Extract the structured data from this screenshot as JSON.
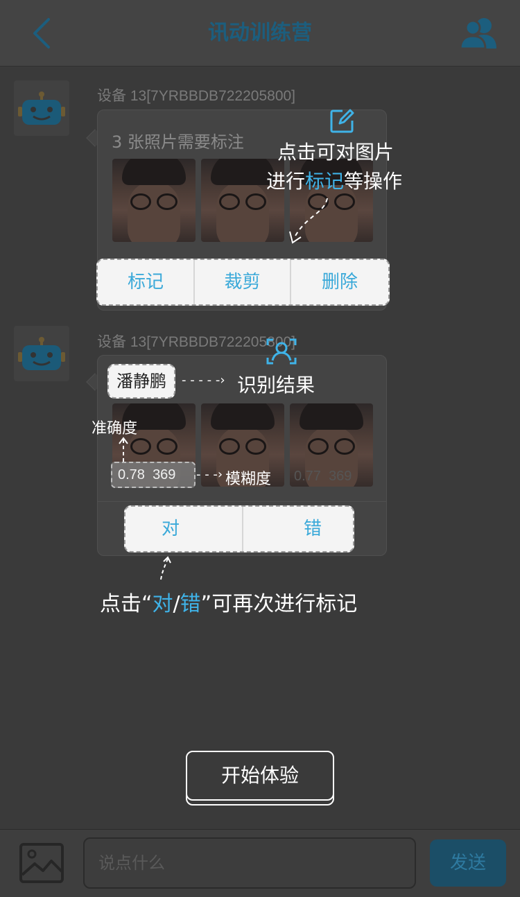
{
  "header": {
    "title": "讯动训练营"
  },
  "messages": [
    {
      "device": "设备 13[7YRBBDB722205800]",
      "text": "3 张照片需要标注",
      "actions": [
        "标记",
        "裁剪",
        "删除"
      ]
    },
    {
      "device": "设备 13[7YRBBDB722205800]",
      "name": "潘静鹏",
      "scores": [
        {
          "accuracy": "0.78",
          "blur": "369"
        },
        {
          "accuracy": "",
          "blur": ""
        },
        {
          "accuracy": "0.77",
          "blur": "369"
        }
      ],
      "actions": [
        "对",
        "错"
      ]
    }
  ],
  "guide": {
    "mark_note_line1": "点击可对图片",
    "mark_note_line2_pre": "进行",
    "mark_note_line2_accent": "标记",
    "mark_note_line2_post": "等操作",
    "result_note": "识别结果",
    "accuracy_note": "准确度",
    "blur_note": "模糊度",
    "bottom_note_pre": "点击“",
    "bottom_note_accent1": "对",
    "bottom_note_slash": "/",
    "bottom_note_accent2": "错",
    "bottom_note_post": "”可再次进行标记",
    "start_label": "开始体验"
  },
  "input": {
    "placeholder": "说点什么",
    "send_label": "发送"
  },
  "colors": {
    "accent": "#3fb3e8",
    "header_title": "#1c5e7e",
    "overlay_bg": "#3a3a3a"
  }
}
